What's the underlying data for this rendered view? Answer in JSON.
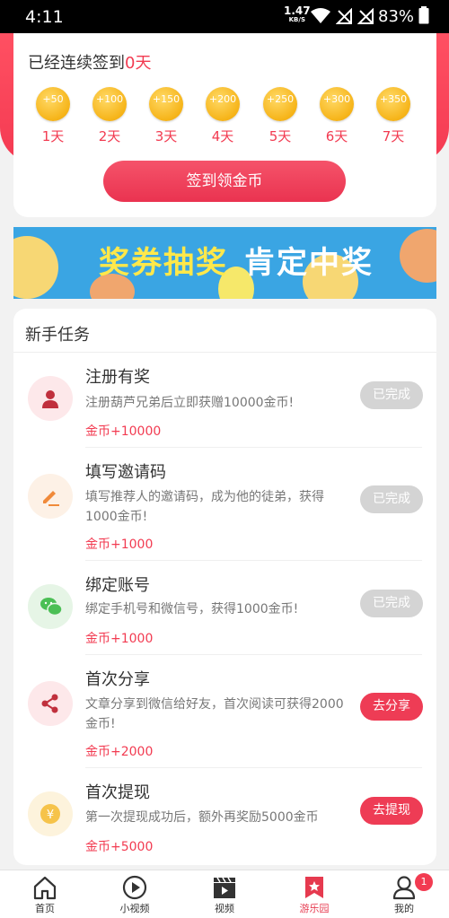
{
  "status_bar": {
    "time": "4:11",
    "net_speed": "1.47",
    "net_unit": "KB/S",
    "battery": "83%"
  },
  "checkin": {
    "prefix": "已经连续签到",
    "days_count": "0天",
    "rewards": [
      {
        "amount": "+50",
        "day": "1天"
      },
      {
        "amount": "+100",
        "day": "2天"
      },
      {
        "amount": "+150",
        "day": "3天"
      },
      {
        "amount": "+200",
        "day": "4天"
      },
      {
        "amount": "+250",
        "day": "5天"
      },
      {
        "amount": "+300",
        "day": "6天"
      },
      {
        "amount": "+350",
        "day": "7天"
      }
    ],
    "button_label": "签到领金币"
  },
  "banner": {
    "text_left": "奖券抽奖",
    "text_right": "肯定中奖"
  },
  "tasks_section": {
    "title": "新手任务",
    "tasks": [
      {
        "name": "注册有奖",
        "desc": "注册葫芦兄弟后立即获赠10000金币!",
        "reward": "金币+10000",
        "action": "已完成",
        "status": "done",
        "icon": "user-icon"
      },
      {
        "name": "填写邀请码",
        "desc": "填写推荐人的邀请码，成为他的徒弟，获得1000金币!",
        "reward": "金币+1000",
        "action": "已完成",
        "status": "done",
        "icon": "pencil-icon"
      },
      {
        "name": "绑定账号",
        "desc": "绑定手机号和微信号，获得1000金币!",
        "reward": "金币+1000",
        "action": "已完成",
        "status": "done",
        "icon": "wechat-icon"
      },
      {
        "name": "首次分享",
        "desc": "文章分享到微信给好友，首次阅读可获得2000金币!",
        "reward": "金币+2000",
        "action": "去分享",
        "status": "todo",
        "icon": "share-icon"
      },
      {
        "name": "首次提现",
        "desc": "第一次提现成功后，额外再奖励5000金币",
        "reward": "金币+5000",
        "action": "去提现",
        "status": "todo",
        "icon": "yen-coin-icon"
      }
    ]
  },
  "tabbar": {
    "tabs": [
      {
        "label": "首页",
        "icon": "home-icon"
      },
      {
        "label": "小视频",
        "icon": "play-circle-icon"
      },
      {
        "label": "视频",
        "icon": "clapperboard-icon"
      },
      {
        "label": "游乐园",
        "icon": "star-bookmark-icon",
        "active": true
      },
      {
        "label": "我的",
        "icon": "person-icon",
        "badge": "1"
      }
    ]
  },
  "colors": {
    "accent": "#f23b51",
    "coin": "#f6b419",
    "done_button": "#d4d4d4",
    "banner_bg": "#3aa5e3"
  }
}
